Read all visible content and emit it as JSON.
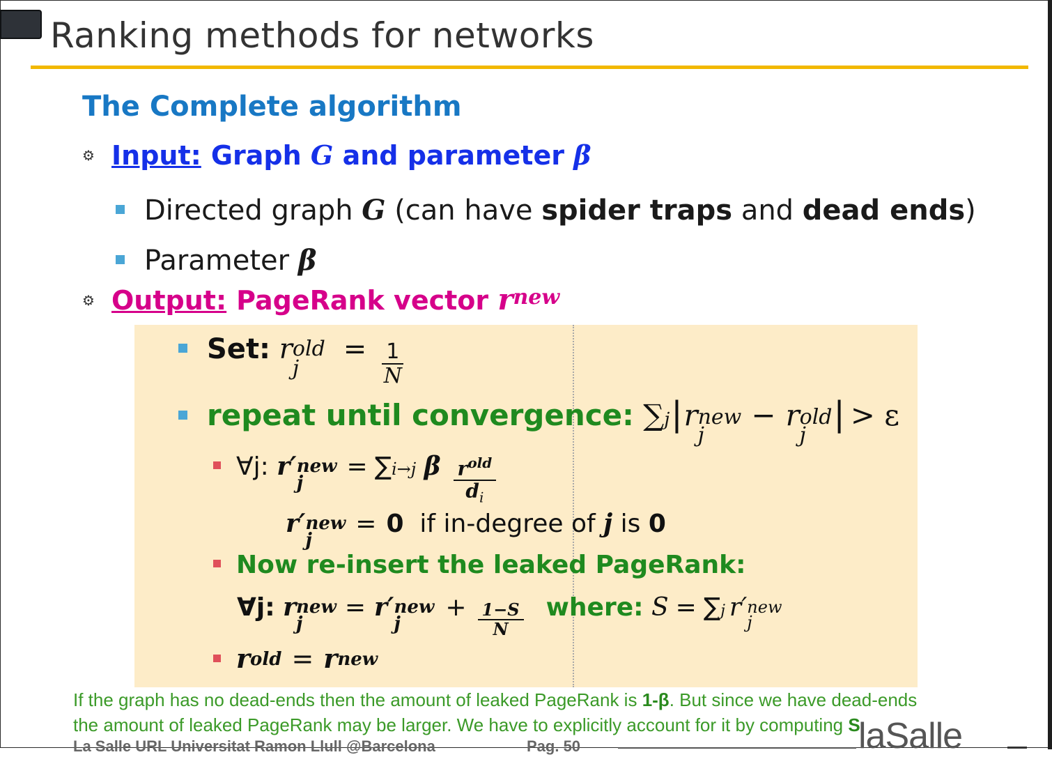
{
  "slide": {
    "title": "Ranking methods for networks",
    "subtitle": "The Complete algorithm",
    "input_label": "Input:",
    "input_text": "Graph",
    "input_G": "G",
    "input_and": "and parameter",
    "input_beta": "β",
    "directed_text": "Directed graph",
    "directed_G": "G",
    "directed_open": "(can have",
    "spider_traps": "spider traps",
    "and": "and",
    "dead_ends": "dead ends",
    "directed_close": ")",
    "parameter_text": "Parameter",
    "parameter_beta": "β",
    "output_label": "Output:",
    "output_text": "PageRank vector",
    "output_r": "r",
    "output_sup": "new"
  },
  "algorithm": {
    "set_label": "Set:",
    "r": "r",
    "sup_old": "old",
    "sub_j": "j",
    "eq": "=",
    "one": "1",
    "N": "N",
    "repeat_label": "repeat until convergence:",
    "sum": "∑",
    "sup_new": "new",
    "minus": "−",
    "gt_eps": "> ε",
    "forall_j": "∀j:",
    "r_prime": "r′",
    "sum_sub_ij": "i→j",
    "beta": "β",
    "d": "d",
    "sub_i": "i",
    "zero": "0",
    "if_indegree": "if in-degree of",
    "j": "j",
    "is": "is",
    "reinsert_label": "Now re-insert the leaked PageRank:",
    "plus": "+",
    "one_minus_S": "1−S",
    "where": "where:",
    "S": "S"
  },
  "note": {
    "line1_a": "If the graph has no dead-ends then the amount of leaked PageRank is ",
    "line1_b": "1-β",
    "line1_c": ". But since we have dead-ends",
    "line2_a": "the amount of leaked PageRank may be larger. We have to explicitly account for it by computing ",
    "line2_b": "S",
    "line2_c": "."
  },
  "footer": {
    "org": "La Salle URL  Universitat Ramon Llull @Barcelona",
    "page": "Pag. 50",
    "logo": "laSalle"
  },
  "colors": {
    "accent_rule": "#f2b800",
    "subtitle_blue": "#1878c4",
    "input_blue": "#1530e8",
    "output_magenta": "#d6008a",
    "box_bg": "#fdecc8",
    "green": "#1f8a1f"
  }
}
